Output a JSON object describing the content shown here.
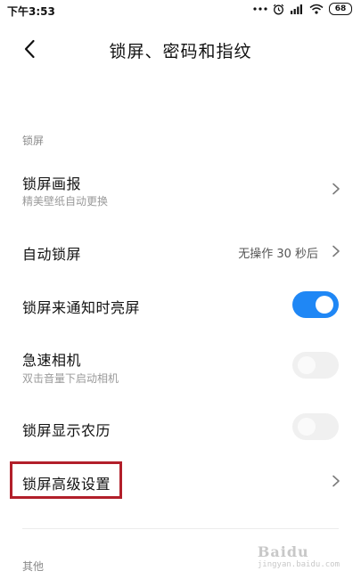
{
  "status_bar": {
    "time": "下午3:53",
    "battery": "68",
    "icons": [
      "more-dots-icon",
      "alarm-icon",
      "signal-icon",
      "wifi-icon",
      "battery-icon"
    ]
  },
  "header": {
    "title": "锁屏、密码和指纹"
  },
  "sections": {
    "lock_screen_label": "锁屏",
    "other_label": "其他"
  },
  "rows": [
    {
      "title": "锁屏画报",
      "subtitle": "精美壁纸自动更换",
      "control": "chevron"
    },
    {
      "title": "自动锁屏",
      "value": "无操作 30 秒后",
      "control": "chevron"
    },
    {
      "title": "锁屏来通知时亮屏",
      "control": "toggle",
      "checked": true
    },
    {
      "title": "急速相机",
      "subtitle": "双击音量下启动相机",
      "control": "toggle",
      "checked": false
    },
    {
      "title": "锁屏显示农历",
      "control": "toggle",
      "checked": false
    },
    {
      "title": "锁屏高级设置",
      "control": "chevron"
    }
  ],
  "colors": {
    "accent": "#1f87f5",
    "highlight_border": "#b21f2a",
    "toggle_off": "#f0f0f0",
    "secondary_text": "#9a9a9a"
  },
  "watermark": {
    "brand": "Baidu",
    "sub": "jingyan.baidu.com"
  }
}
